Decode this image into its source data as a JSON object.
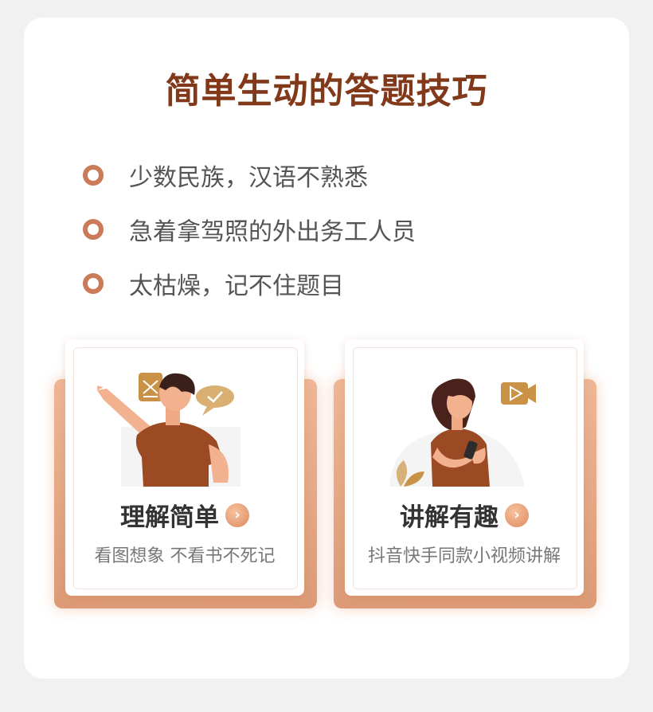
{
  "title": "简单生动的答题技巧",
  "bullets": [
    {
      "text": "少数民族，汉语不熟悉"
    },
    {
      "text": "急着拿驾照的外出务工人员"
    },
    {
      "text": "太枯燥，记不住题目"
    }
  ],
  "cards": [
    {
      "title": "理解简单",
      "subtitle": "看图想象 不看书不死记",
      "arrow": "›",
      "illustration": "man-pointing-with-document-and-check-bubble"
    },
    {
      "title": "讲解有趣",
      "subtitle": "抖音快手同款小视频讲解",
      "arrow": "›",
      "illustration": "woman-using-phone-with-video-icon"
    }
  ],
  "colors": {
    "title": "#82391a",
    "bullet": "#c97b5a",
    "card_back": "#e6a683",
    "arrow": "#e59a72"
  }
}
